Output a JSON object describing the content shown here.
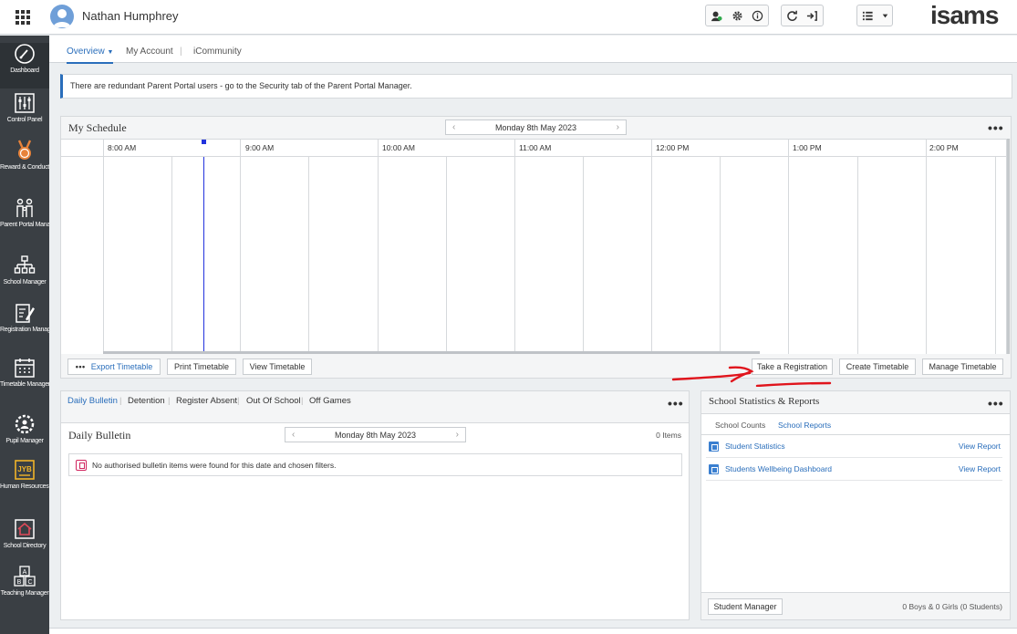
{
  "header": {
    "user_name": "Nathan Humphrey",
    "logo": "isams",
    "icons_group1": [
      "user-status-icon",
      "gear-icon",
      "info-icon"
    ],
    "icons_group2": [
      "refresh-icon",
      "sign-out-icon"
    ],
    "icons_group3": [
      "list-icon",
      "caret-down-icon"
    ]
  },
  "sidebar": {
    "items": [
      {
        "label": "Dashboard",
        "icon": "dashboard-icon"
      },
      {
        "label": "Control Panel",
        "icon": "sliders-icon"
      },
      {
        "label": "Reward & Conduct Manager",
        "icon": "medal-icon"
      },
      {
        "label": "Parent Portal Manager",
        "icon": "family-icon"
      },
      {
        "label": "School Manager",
        "icon": "org-chart-icon"
      },
      {
        "label": "Registration Manager",
        "icon": "clipboard-pen-icon"
      },
      {
        "label": "Timetable Manager",
        "icon": "calendar-icon"
      },
      {
        "label": "Pupil Manager",
        "icon": "gear-person-icon"
      },
      {
        "label": "Human Resources Manager",
        "icon": "id-card-icon"
      },
      {
        "label": "School Directory",
        "icon": "house-icon"
      },
      {
        "label": "Teaching Manager",
        "icon": "abc-blocks-icon"
      }
    ]
  },
  "subnav": {
    "tabs": [
      {
        "label": "Overview"
      },
      {
        "label": "My Account"
      },
      {
        "label": "iCommunity"
      }
    ],
    "separator": "|"
  },
  "alert": {
    "text": "There are redundant Parent Portal users - go to the Security tab of the Parent Portal Manager."
  },
  "schedule": {
    "title": "My Schedule",
    "date": "Monday 8th May 2023",
    "times": [
      "8:00 AM",
      "9:00 AM",
      "10:00 AM",
      "11:00 AM",
      "12:00 PM",
      "1:00 PM",
      "2:00 PM"
    ],
    "buttons": {
      "export": "Export Timetable",
      "print": "Print Timetable",
      "view": "View Timetable",
      "take_registration": "Take a Registration",
      "create": "Create Timetable",
      "manage": "Manage Timetable"
    },
    "more": "•••"
  },
  "bulletin": {
    "tabs": [
      {
        "label": "Daily Bulletin"
      },
      {
        "label": "Detention"
      },
      {
        "label": "Register Absent"
      },
      {
        "label": "Out Of School"
      },
      {
        "label": "Off Games"
      }
    ],
    "separator": "|",
    "title": "Daily Bulletin",
    "date": "Monday 8th May 2023",
    "items_count": "0 Items",
    "empty_message": "No authorised bulletin items were found for this date and chosen filters.",
    "more": "•••"
  },
  "stats": {
    "title": "School Statistics & Reports",
    "tabs": [
      {
        "label": "School Counts"
      },
      {
        "label": "School Reports"
      }
    ],
    "reports": [
      {
        "name": "Student Statistics",
        "link": "View Report"
      },
      {
        "name": "Students Wellbeing Dashboard",
        "link": "View Report"
      }
    ],
    "footer_button": "Student Manager",
    "footer_count": "0 Boys & 0 Girls (0 Students)",
    "more": "•••"
  },
  "arrows": {
    "left": "‹",
    "right": "›"
  },
  "colors": {
    "accent": "#2a6ebb",
    "sidebar": "#3a3f44",
    "annotation": "#e0141c",
    "now_line": "#2233dd"
  }
}
